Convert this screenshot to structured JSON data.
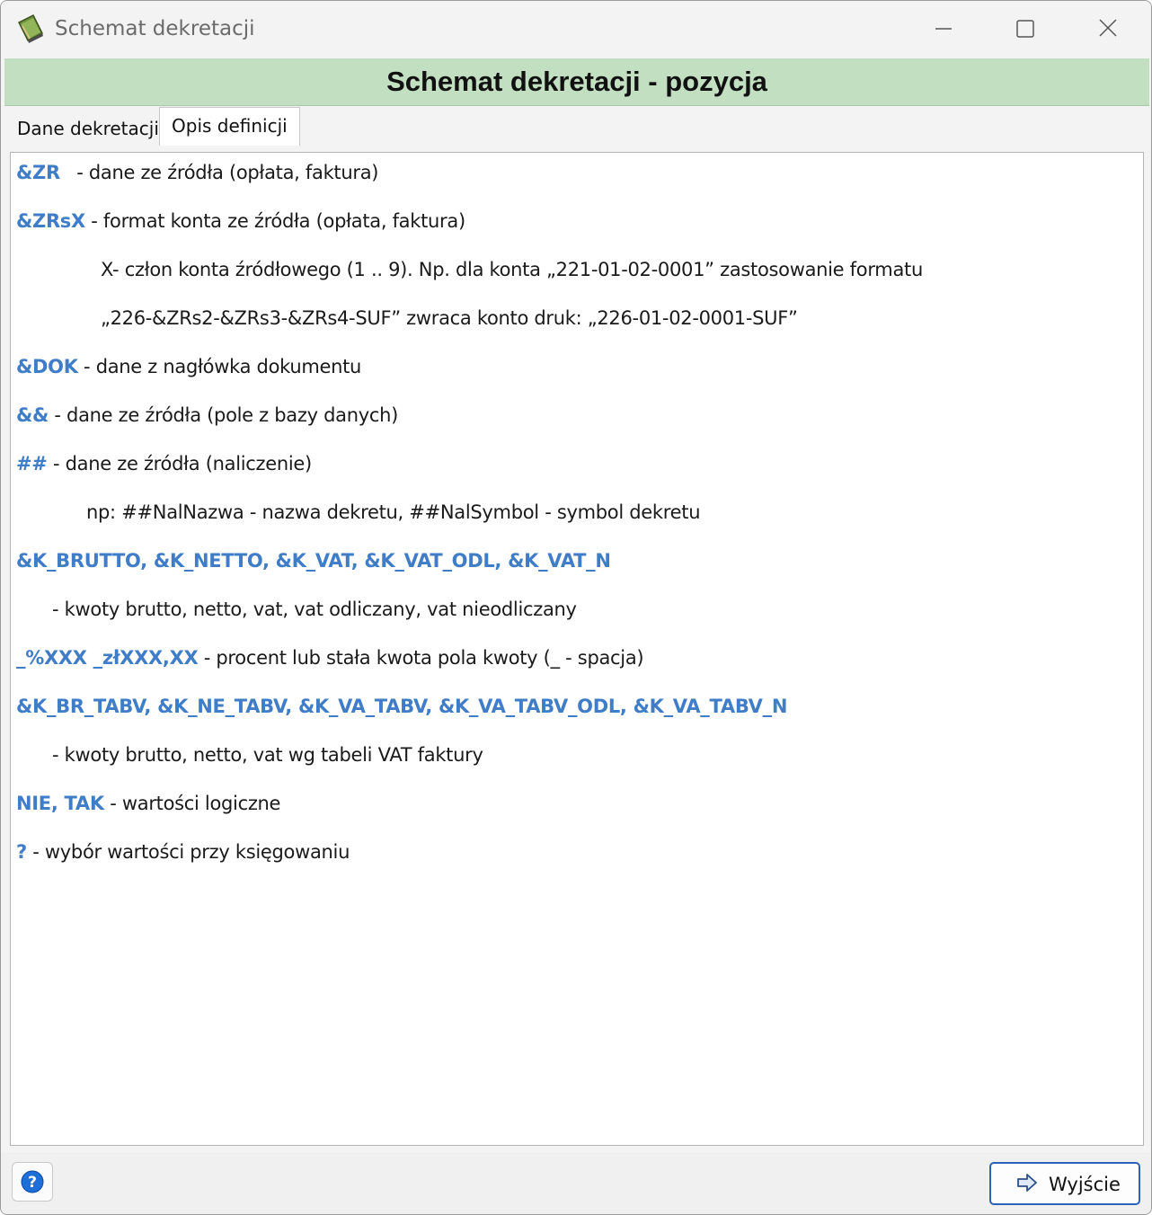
{
  "window": {
    "title": "Schemat dekretacji",
    "icon": "book-icon",
    "controls": [
      "minimize-icon",
      "maximize-icon",
      "close-icon"
    ]
  },
  "header": {
    "title": "Schemat dekretacji - pozycja"
  },
  "tabs": [
    {
      "label": "Dane dekretacji",
      "active": false
    },
    {
      "label": "Opis definicji",
      "active": true
    }
  ],
  "content": {
    "lines": [
      {
        "kw": "&ZR",
        "text": " - dane ze źródła (opłata, faktura)"
      },
      {
        "kw": "&ZRsX",
        "text": " - format konta ze źródła (opłata, faktura)"
      },
      {
        "kw": "",
        "text": "X- człon konta źródłowego (1 .. 9). Np. dla konta „221-01-02-0001” zastosowanie formatu"
      },
      {
        "kw": "",
        "text": "„226-&ZRs2-&ZRs3-&ZRs4-SUF” zwraca konto druk: „226-01-02-0001-SUF”"
      },
      {
        "kw": "&DOK",
        "text": " - dane z nagłówka dokumentu"
      },
      {
        "kw": "&&",
        "text": " -  dane ze źródła (pole z bazy danych)"
      },
      {
        "kw": "##",
        "text": " -  dane ze źródła (naliczenie)"
      },
      {
        "kw": "",
        "text": "np: ##NalNazwa - nazwa dekretu, ##NalSymbol - symbol dekretu"
      },
      {
        "kw": "&K_BRUTTO, &K_NETTO, &K_VAT, &K_VAT_ODL, &K_VAT_N",
        "text": ""
      },
      {
        "kw": "",
        "text": "- kwoty brutto, netto, vat, vat odliczany, vat nieodliczany"
      },
      {
        "kw": "_%XXX _złXXX,XX",
        "text": " - procent lub stała kwota pola kwoty (_ - spacja)"
      },
      {
        "kw": "&K_BR_TABV, &K_NE_TABV, &K_VA_TABV, &K_VA_TABV_ODL, &K_VA_TABV_N",
        "text": ""
      },
      {
        "kw": "",
        "text": "- kwoty brutto, netto, vat wg tabeli VAT faktury"
      },
      {
        "kw": "NIE, TAK",
        "text": " - wartości logiczne"
      },
      {
        "kw": "?",
        "text": " - wybór wartości przy księgowaniu"
      }
    ]
  },
  "footer": {
    "help_icon": "help-icon",
    "exit_label": "Wyjście",
    "exit_icon": "arrow-right-icon",
    "accent": "#2a63b8"
  }
}
